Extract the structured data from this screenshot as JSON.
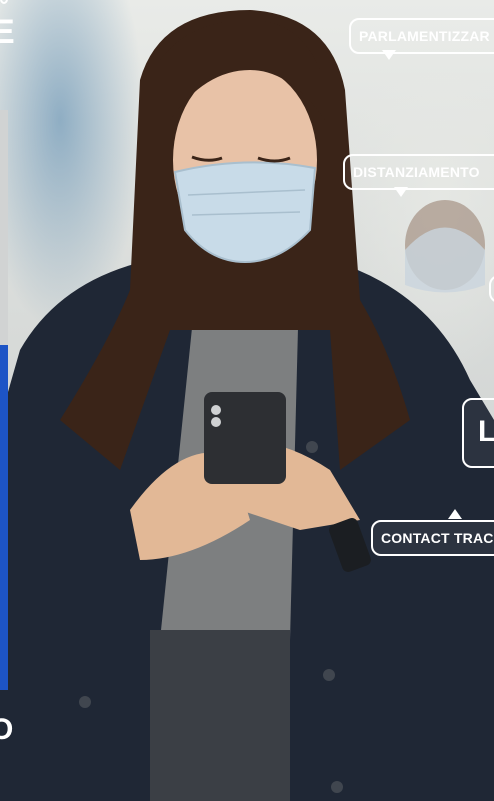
{
  "bubbles": {
    "parlamentizzare": "PARLAMENTIZZAR",
    "distanziamento": "DISTANZIAMENTO",
    "partial_large": "L",
    "contact_tracing": "CONTACT TRAC"
  },
  "left_fragments": {
    "top_letter": "E",
    "bottom_letter": "O"
  },
  "colors": {
    "accent_blue": "#1d54c6",
    "bubble_outline": "#ffffff"
  },
  "image": {
    "subject": "woman wearing surgical mask looking at smartphone"
  }
}
